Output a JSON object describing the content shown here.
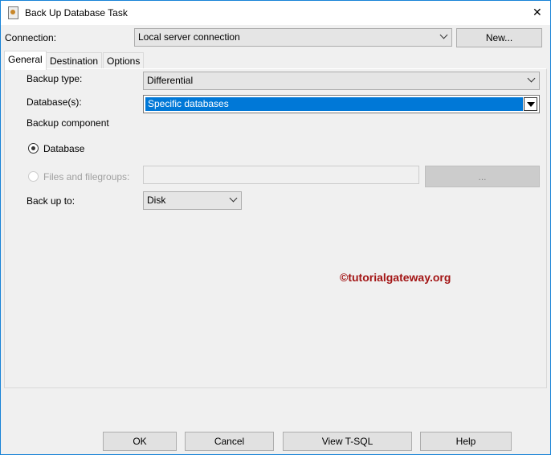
{
  "window": {
    "title": "Back Up Database Task",
    "close": "✕"
  },
  "connection": {
    "label": "Connection:",
    "value": "Local server connection",
    "new_button": "New..."
  },
  "tabs": [
    {
      "label": "General"
    },
    {
      "label": "Destination"
    },
    {
      "label": "Options"
    }
  ],
  "general": {
    "backup_type_label": "Backup type:",
    "backup_type_value": "Differential",
    "databases_label": "Database(s):",
    "databases_value": "Specific databases",
    "backup_component_label": "Backup component",
    "radio_database": "Database",
    "radio_files": "Files and filegroups:",
    "files_browse": "...",
    "back_up_to_label": "Back up to:",
    "back_up_to_value": "Disk"
  },
  "watermark": "©tutorialgateway.org",
  "buttons": {
    "ok": "OK",
    "cancel": "Cancel",
    "view_tsql": "View T-SQL",
    "help": "Help"
  }
}
